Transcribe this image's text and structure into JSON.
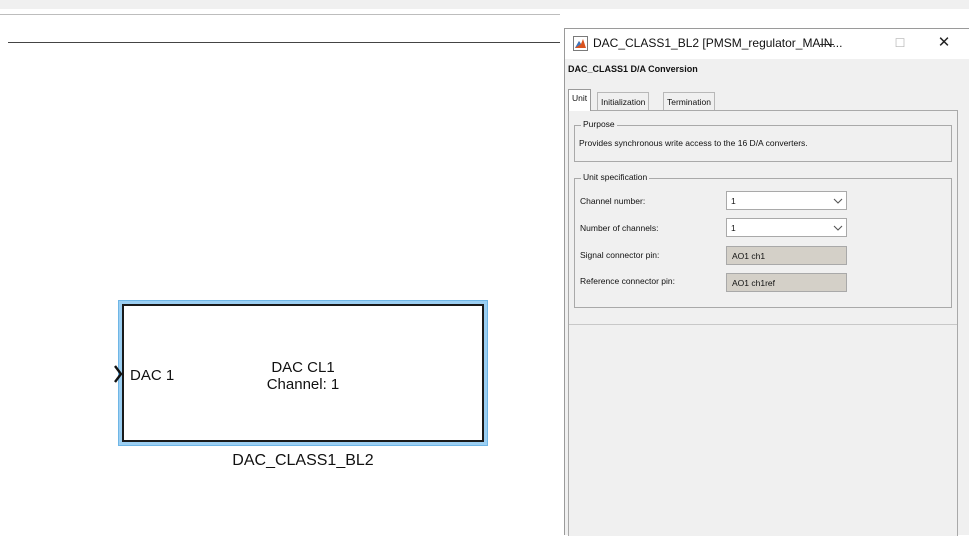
{
  "canvas": {
    "block": {
      "port_label": "DAC 1",
      "center_line1": "DAC CL1",
      "center_line2": "Channel: 1",
      "name": "DAC_CLASS1_BL2"
    }
  },
  "dialog": {
    "title": "DAC_CLASS1_BL2  [PMSM_regulator_MAIN...",
    "window_buttons": {
      "minimize": "—",
      "maximize": "☐",
      "close": "✕"
    },
    "heading": "DAC_CLASS1  D/A Conversion",
    "tabs": [
      {
        "label": "Unit",
        "active": true
      },
      {
        "label": "Initialization",
        "active": false
      },
      {
        "label": "Termination",
        "active": false
      }
    ],
    "purpose": {
      "legend": "Purpose",
      "text": "Provides synchronous write access to the 16 D/A converters."
    },
    "unit_spec": {
      "legend": "Unit specification",
      "channel_number": {
        "label": "Channel number:",
        "value": "1"
      },
      "number_of_channels": {
        "label": "Number of channels:",
        "value": "1"
      },
      "signal_pin": {
        "label": "Signal connector pin:",
        "value": "AO1 ch1"
      },
      "reference_pin": {
        "label": "Reference connector pin:",
        "value": "AO1 ch1ref"
      }
    }
  },
  "colors": {
    "selection": "#9ccff2",
    "dialog_bg": "#f0f0f0",
    "readonly_bg": "#d4d0c8"
  },
  "icons": [
    "matlab-icon",
    "chevron-down-icon",
    "input-port-chevron-icon"
  ]
}
